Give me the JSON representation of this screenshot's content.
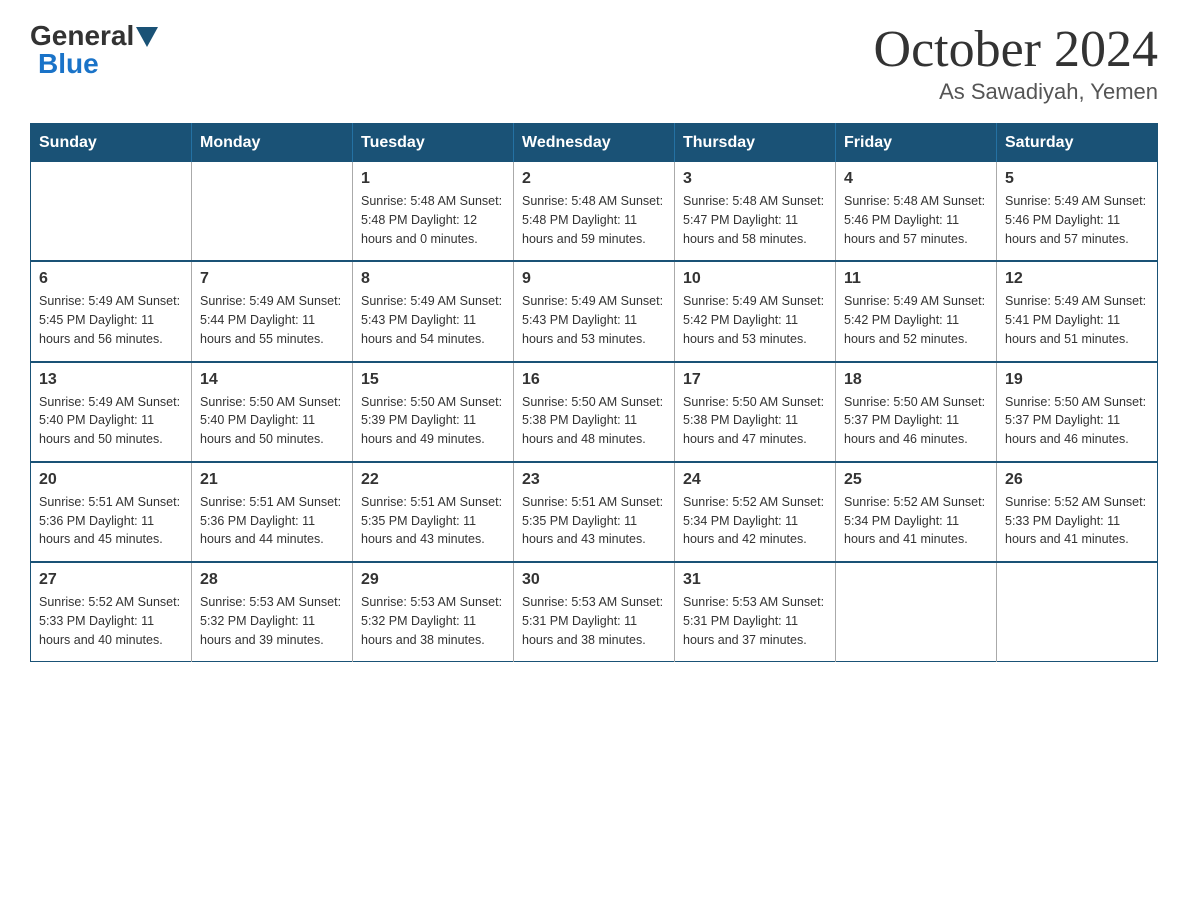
{
  "logo": {
    "general": "General",
    "blue": "Blue"
  },
  "title": {
    "month_year": "October 2024",
    "location": "As Sawadiyah, Yemen"
  },
  "days_header": [
    "Sunday",
    "Monday",
    "Tuesday",
    "Wednesday",
    "Thursday",
    "Friday",
    "Saturday"
  ],
  "weeks": [
    [
      {
        "day": "",
        "info": ""
      },
      {
        "day": "",
        "info": ""
      },
      {
        "day": "1",
        "info": "Sunrise: 5:48 AM\nSunset: 5:48 PM\nDaylight: 12 hours\nand 0 minutes."
      },
      {
        "day": "2",
        "info": "Sunrise: 5:48 AM\nSunset: 5:48 PM\nDaylight: 11 hours\nand 59 minutes."
      },
      {
        "day": "3",
        "info": "Sunrise: 5:48 AM\nSunset: 5:47 PM\nDaylight: 11 hours\nand 58 minutes."
      },
      {
        "day": "4",
        "info": "Sunrise: 5:48 AM\nSunset: 5:46 PM\nDaylight: 11 hours\nand 57 minutes."
      },
      {
        "day": "5",
        "info": "Sunrise: 5:49 AM\nSunset: 5:46 PM\nDaylight: 11 hours\nand 57 minutes."
      }
    ],
    [
      {
        "day": "6",
        "info": "Sunrise: 5:49 AM\nSunset: 5:45 PM\nDaylight: 11 hours\nand 56 minutes."
      },
      {
        "day": "7",
        "info": "Sunrise: 5:49 AM\nSunset: 5:44 PM\nDaylight: 11 hours\nand 55 minutes."
      },
      {
        "day": "8",
        "info": "Sunrise: 5:49 AM\nSunset: 5:43 PM\nDaylight: 11 hours\nand 54 minutes."
      },
      {
        "day": "9",
        "info": "Sunrise: 5:49 AM\nSunset: 5:43 PM\nDaylight: 11 hours\nand 53 minutes."
      },
      {
        "day": "10",
        "info": "Sunrise: 5:49 AM\nSunset: 5:42 PM\nDaylight: 11 hours\nand 53 minutes."
      },
      {
        "day": "11",
        "info": "Sunrise: 5:49 AM\nSunset: 5:42 PM\nDaylight: 11 hours\nand 52 minutes."
      },
      {
        "day": "12",
        "info": "Sunrise: 5:49 AM\nSunset: 5:41 PM\nDaylight: 11 hours\nand 51 minutes."
      }
    ],
    [
      {
        "day": "13",
        "info": "Sunrise: 5:49 AM\nSunset: 5:40 PM\nDaylight: 11 hours\nand 50 minutes."
      },
      {
        "day": "14",
        "info": "Sunrise: 5:50 AM\nSunset: 5:40 PM\nDaylight: 11 hours\nand 50 minutes."
      },
      {
        "day": "15",
        "info": "Sunrise: 5:50 AM\nSunset: 5:39 PM\nDaylight: 11 hours\nand 49 minutes."
      },
      {
        "day": "16",
        "info": "Sunrise: 5:50 AM\nSunset: 5:38 PM\nDaylight: 11 hours\nand 48 minutes."
      },
      {
        "day": "17",
        "info": "Sunrise: 5:50 AM\nSunset: 5:38 PM\nDaylight: 11 hours\nand 47 minutes."
      },
      {
        "day": "18",
        "info": "Sunrise: 5:50 AM\nSunset: 5:37 PM\nDaylight: 11 hours\nand 46 minutes."
      },
      {
        "day": "19",
        "info": "Sunrise: 5:50 AM\nSunset: 5:37 PM\nDaylight: 11 hours\nand 46 minutes."
      }
    ],
    [
      {
        "day": "20",
        "info": "Sunrise: 5:51 AM\nSunset: 5:36 PM\nDaylight: 11 hours\nand 45 minutes."
      },
      {
        "day": "21",
        "info": "Sunrise: 5:51 AM\nSunset: 5:36 PM\nDaylight: 11 hours\nand 44 minutes."
      },
      {
        "day": "22",
        "info": "Sunrise: 5:51 AM\nSunset: 5:35 PM\nDaylight: 11 hours\nand 43 minutes."
      },
      {
        "day": "23",
        "info": "Sunrise: 5:51 AM\nSunset: 5:35 PM\nDaylight: 11 hours\nand 43 minutes."
      },
      {
        "day": "24",
        "info": "Sunrise: 5:52 AM\nSunset: 5:34 PM\nDaylight: 11 hours\nand 42 minutes."
      },
      {
        "day": "25",
        "info": "Sunrise: 5:52 AM\nSunset: 5:34 PM\nDaylight: 11 hours\nand 41 minutes."
      },
      {
        "day": "26",
        "info": "Sunrise: 5:52 AM\nSunset: 5:33 PM\nDaylight: 11 hours\nand 41 minutes."
      }
    ],
    [
      {
        "day": "27",
        "info": "Sunrise: 5:52 AM\nSunset: 5:33 PM\nDaylight: 11 hours\nand 40 minutes."
      },
      {
        "day": "28",
        "info": "Sunrise: 5:53 AM\nSunset: 5:32 PM\nDaylight: 11 hours\nand 39 minutes."
      },
      {
        "day": "29",
        "info": "Sunrise: 5:53 AM\nSunset: 5:32 PM\nDaylight: 11 hours\nand 38 minutes."
      },
      {
        "day": "30",
        "info": "Sunrise: 5:53 AM\nSunset: 5:31 PM\nDaylight: 11 hours\nand 38 minutes."
      },
      {
        "day": "31",
        "info": "Sunrise: 5:53 AM\nSunset: 5:31 PM\nDaylight: 11 hours\nand 37 minutes."
      },
      {
        "day": "",
        "info": ""
      },
      {
        "day": "",
        "info": ""
      }
    ]
  ]
}
